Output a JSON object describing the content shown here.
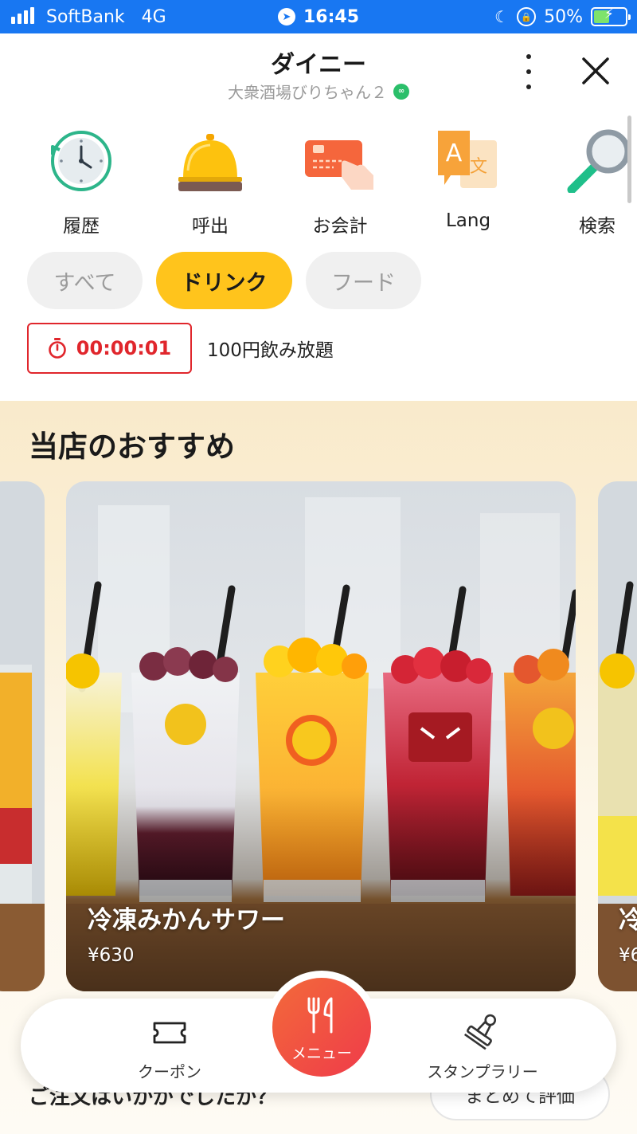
{
  "status_bar": {
    "carrier": "SoftBank",
    "network": "4G",
    "time": "16:45",
    "battery": "50%",
    "battery_level": 0.5
  },
  "header": {
    "title": "ダイニー",
    "subtitle": "大衆酒場びりちゃん２"
  },
  "quick_actions": [
    {
      "label": "履歴",
      "icon": "history-clock-icon"
    },
    {
      "label": "呼出",
      "icon": "call-bell-icon"
    },
    {
      "label": "お会計",
      "icon": "payment-card-icon"
    },
    {
      "label": "Lang",
      "icon": "language-icon"
    },
    {
      "label": "検索",
      "icon": "search-icon"
    }
  ],
  "categories": [
    {
      "label": "すべて",
      "active": false
    },
    {
      "label": "ドリンク",
      "active": true
    },
    {
      "label": "フード",
      "active": false
    }
  ],
  "timer": {
    "value": "00:00:01",
    "label": "100円飲み放題"
  },
  "recommendations": {
    "title": "当店のおすすめ",
    "items": [
      {
        "name": "冷凍みかんサワー",
        "price": "¥630"
      }
    ],
    "right_peek": {
      "name": "冷",
      "price": "¥6"
    }
  },
  "next_section": {
    "title": "ご注文はいかがでしたか？",
    "button": "まとめて評価"
  },
  "bottom_nav": {
    "coupon": "クーポン",
    "menu": "メニュー",
    "stamp": "スタンプラリー"
  },
  "colors": {
    "status_bar": "#1877f2",
    "accent_yellow": "#ffc41c",
    "timer_red": "#e0262c",
    "menu_orange": "#f05a3f"
  }
}
